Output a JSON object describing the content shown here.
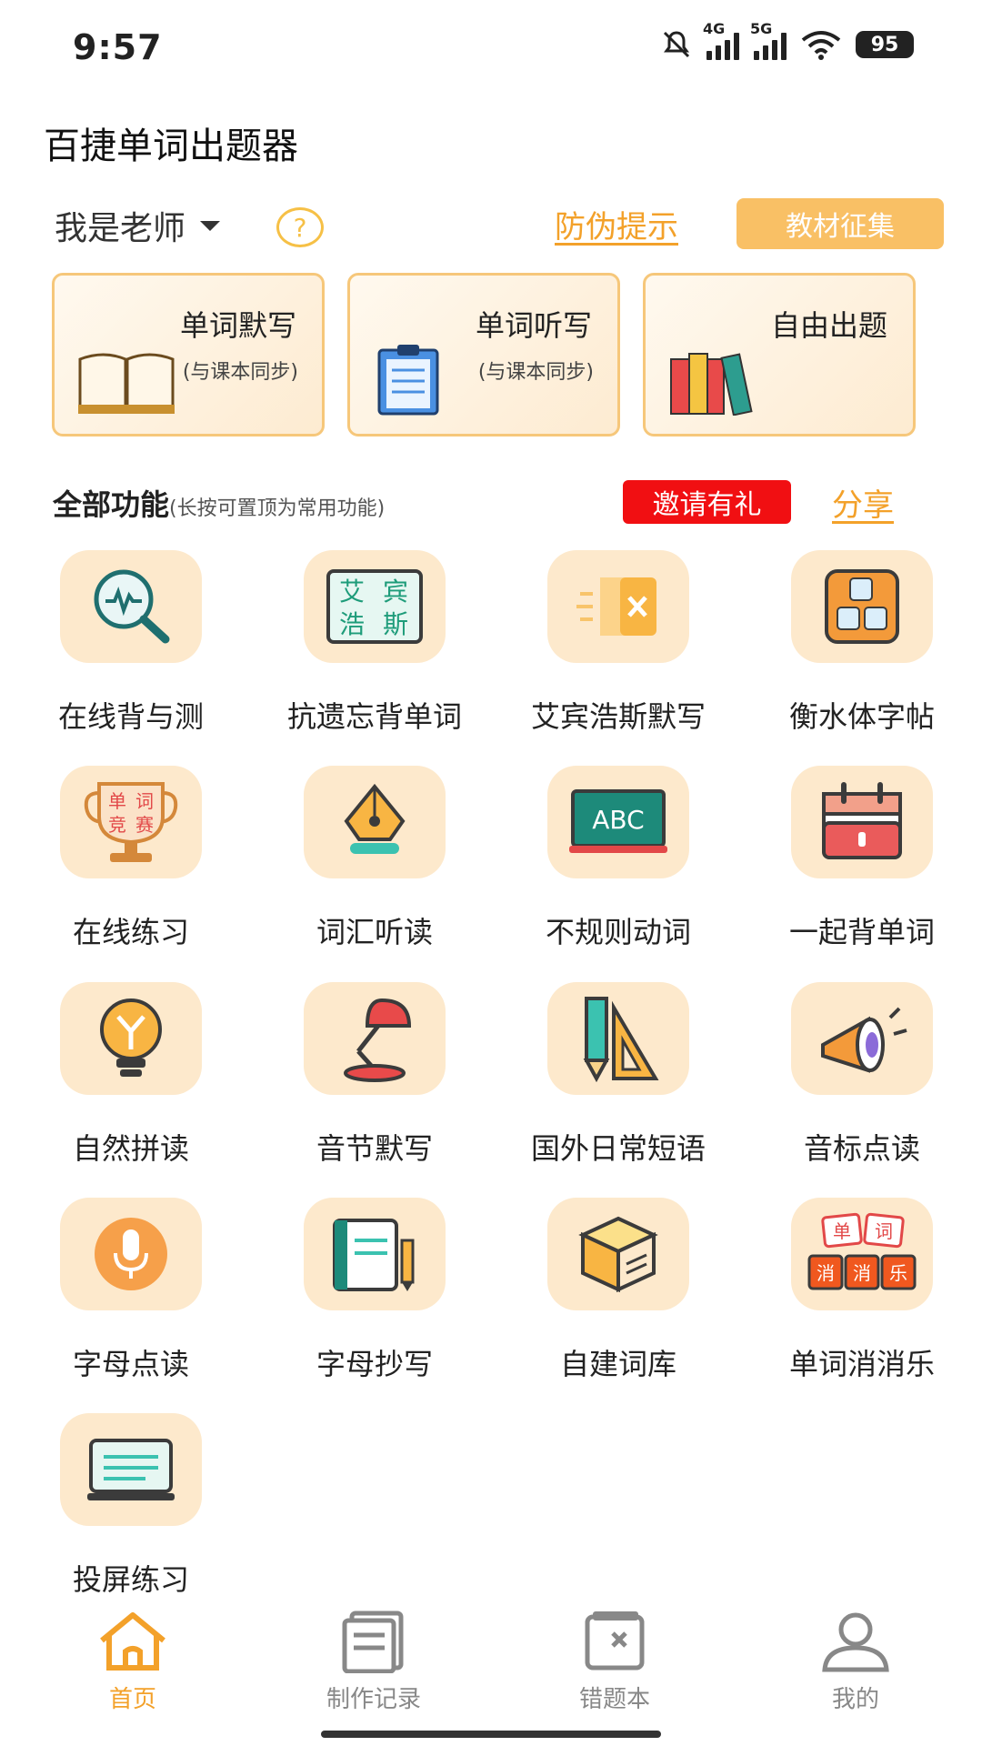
{
  "status_bar": {
    "time": "9:57",
    "net1": "4G",
    "net2": "5G",
    "battery": "95"
  },
  "app_title": "百捷单词出题器",
  "role": {
    "label": "我是老师",
    "help": "?"
  },
  "links": {
    "anti_fake": "防伪提示",
    "collect": "教材征集"
  },
  "cards": [
    {
      "title": "单词默写",
      "subtitle": "(与课本同步)",
      "icon": "open-book-icon"
    },
    {
      "title": "单词听写",
      "subtitle": "(与课本同步)",
      "icon": "clipboard-icon"
    },
    {
      "title": "自由出题",
      "subtitle": "",
      "icon": "books-icon"
    }
  ],
  "section": {
    "title": "全部功能",
    "hint": "(长按可置顶为常用功能)",
    "invite": "邀请有礼",
    "share": "分享"
  },
  "features": [
    {
      "label": "在线背与测",
      "icon": "magnifier-icon"
    },
    {
      "label": "抗遗忘背单词",
      "icon": "ebbinghaus-icon",
      "t1": "艾",
      "t2": "宾",
      "t3": "浩",
      "t4": "斯"
    },
    {
      "label": "艾宾浩斯默写",
      "icon": "x-card-icon"
    },
    {
      "label": "衡水体字帖",
      "icon": "abc-blocks-icon"
    },
    {
      "label": "在线练习",
      "icon": "trophy-icon",
      "t1": "单",
      "t2": "词",
      "t3": "竞",
      "t4": "赛"
    },
    {
      "label": "词汇听读",
      "icon": "pen-nib-icon"
    },
    {
      "label": "不规则动词",
      "icon": "chalkboard-icon",
      "board": "ABC"
    },
    {
      "label": "一起背单词",
      "icon": "calendar-icon"
    },
    {
      "label": "自然拼读",
      "icon": "lightbulb-icon"
    },
    {
      "label": "音节默写",
      "icon": "desk-lamp-icon"
    },
    {
      "label": "国外日常短语",
      "icon": "ruler-pencil-icon"
    },
    {
      "label": "音标点读",
      "icon": "megaphone-icon"
    },
    {
      "label": "字母点读",
      "icon": "microphone-icon"
    },
    {
      "label": "字母抄写",
      "icon": "notebook-pencil-icon"
    },
    {
      "label": "自建词库",
      "icon": "cube-icon"
    },
    {
      "label": "单词消消乐",
      "icon": "word-tiles-icon",
      "t1": "单",
      "t2": "词",
      "t3": "消",
      "t4": "消",
      "t5": "乐"
    },
    {
      "label": "投屏练习",
      "icon": "screen-icon"
    }
  ],
  "nav": [
    {
      "label": "首页",
      "icon": "home-icon",
      "active": true
    },
    {
      "label": "制作记录",
      "icon": "records-icon"
    },
    {
      "label": "错题本",
      "icon": "wrong-book-icon"
    },
    {
      "label": "我的",
      "icon": "profile-icon"
    }
  ],
  "colors": {
    "accent": "#f3a12a",
    "icon_bg": "#fde9cc",
    "invite": "#f10f12",
    "card_border": "#f6c77a"
  }
}
